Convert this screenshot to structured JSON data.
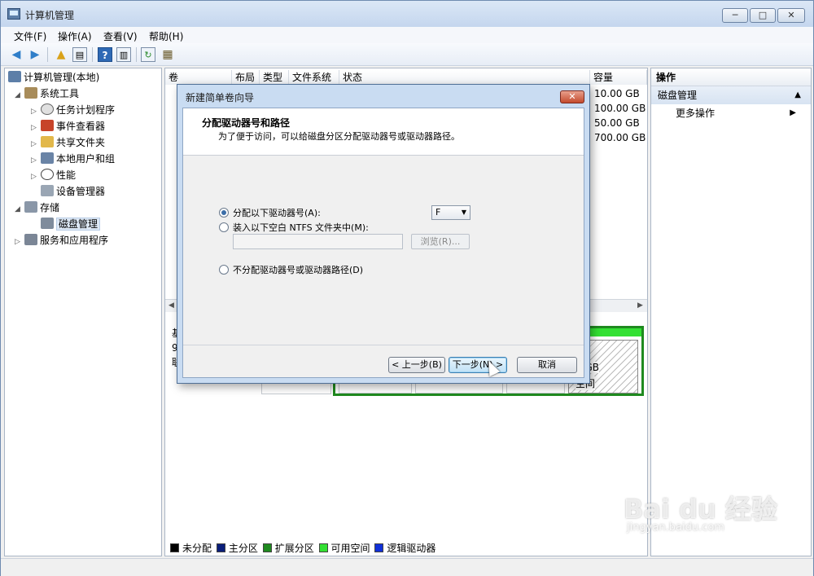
{
  "window": {
    "title": "计算机管理",
    "min": "─",
    "max": "□",
    "close": "✕"
  },
  "menu": [
    "文件(F)",
    "操作(A)",
    "查看(V)",
    "帮助(H)"
  ],
  "tree": {
    "root": "计算机管理(本地)",
    "items": [
      {
        "label": "系统工具"
      },
      {
        "label": "任务计划程序"
      },
      {
        "label": "事件查看器"
      },
      {
        "label": "共享文件夹"
      },
      {
        "label": "本地用户和组"
      },
      {
        "label": "性能"
      },
      {
        "label": "设备管理器"
      },
      {
        "label": "存储"
      },
      {
        "label": "磁盘管理"
      },
      {
        "label": "服务和应用程序"
      }
    ]
  },
  "volumes": {
    "columns": [
      "卷",
      "布局",
      "类型",
      "文件系统",
      "状态",
      "容量"
    ],
    "capacities": [
      "10.00 GB",
      "100.00 GB",
      "50.00 GB",
      "700.00 GB"
    ]
  },
  "diskmap": {
    "left_fragments": [
      "基",
      "9",
      "联"
    ],
    "size_fragment": "0 GB",
    "status_fragment": "空间"
  },
  "legend": [
    {
      "label": "未分配",
      "color": "#000000"
    },
    {
      "label": "主分区",
      "color": "#0a1e7a"
    },
    {
      "label": "扩展分区",
      "color": "#1f8a1f"
    },
    {
      "label": "可用空间",
      "color": "#33e033"
    },
    {
      "label": "逻辑驱动器",
      "color": "#1030d8"
    }
  ],
  "actions": {
    "header": "操作",
    "section": "磁盘管理",
    "more": "更多操作"
  },
  "wizard": {
    "title": "新建简单卷向导",
    "heading": "分配驱动器号和路径",
    "subheading": "为了便于访问，可以给磁盘分区分配驱动器号或驱动器路径。",
    "option_assign": "分配以下驱动器号(A):",
    "drive_letter": "F",
    "option_mount": "装入以下空白 NTFS 文件夹中(M):",
    "browse": "浏览(R)...",
    "option_none": "不分配驱动器号或驱动器路径(D)",
    "back": "< 上一步(B)",
    "next": "下一步(N) >",
    "cancel": "取消"
  },
  "watermark": {
    "brand": "Bai du 经验",
    "url": "jingyan.baidu.com"
  }
}
